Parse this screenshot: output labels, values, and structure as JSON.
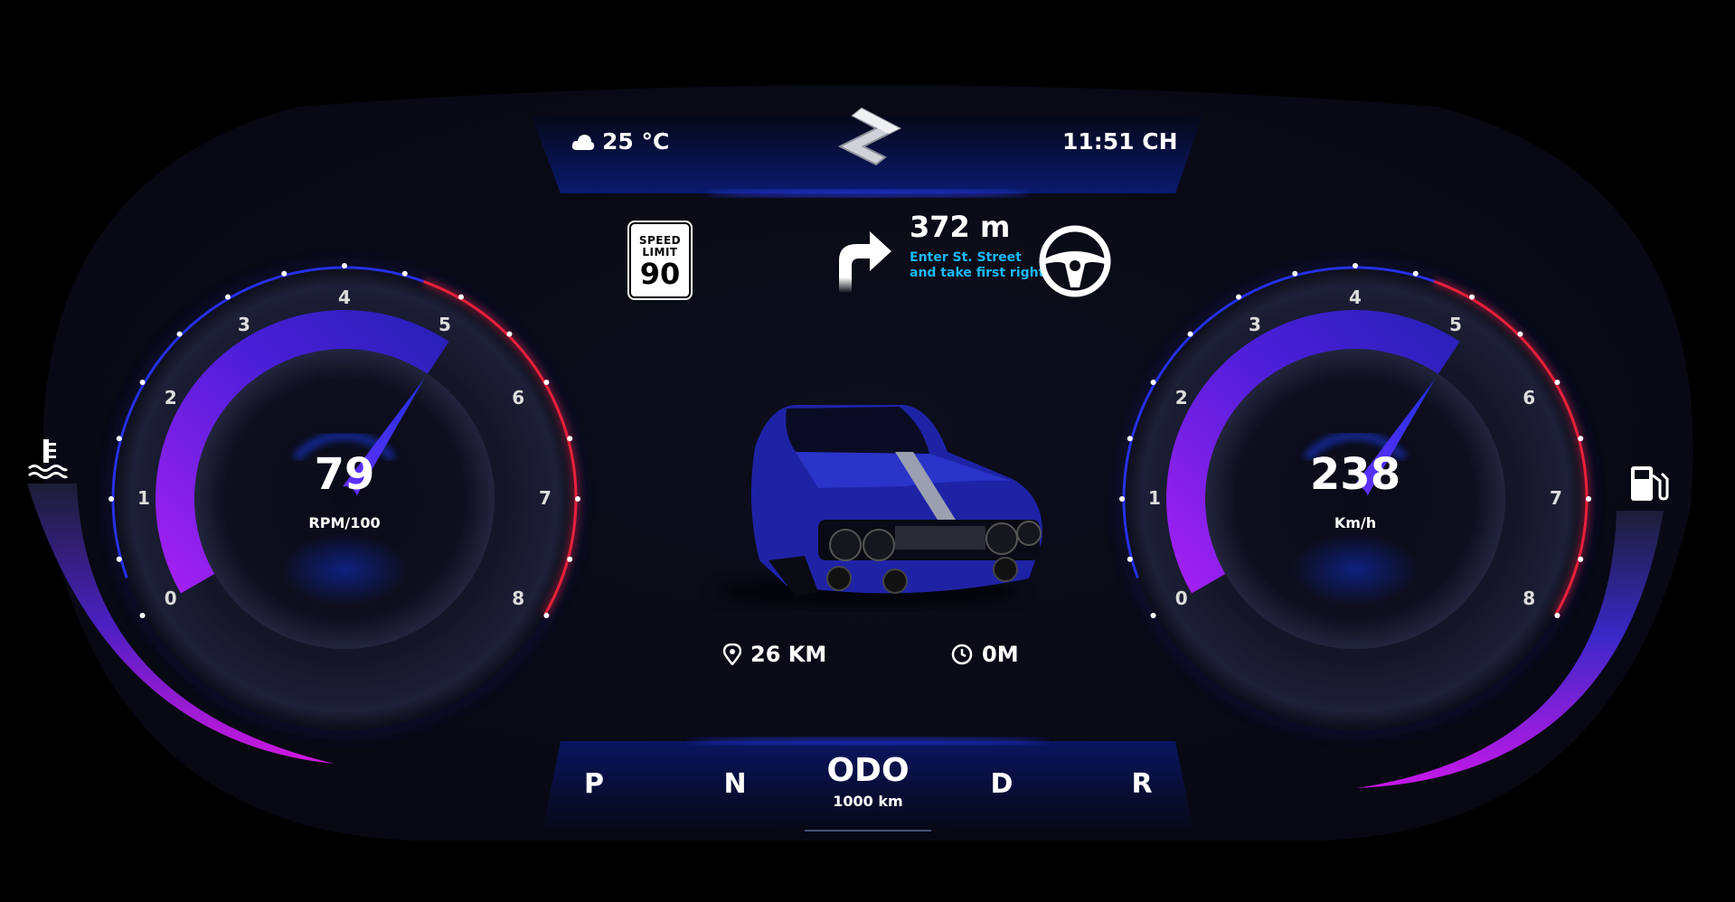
{
  "header": {
    "temperature": "25 °C",
    "time": "11:51 CH",
    "weather_icon": "cloud-icon",
    "logo": "suzuki-logo"
  },
  "speed_limit": {
    "label_line1": "SPEED",
    "label_line2": "LIMIT",
    "value": "90"
  },
  "navigation": {
    "distance": "372 m",
    "instruction": "Enter St. Street and take first right",
    "arrow_icon": "turn-right-icon",
    "wheel_icon": "steering-wheel-icon",
    "instruction_color": "#19b8f5"
  },
  "rpm_gauge": {
    "value": "79",
    "unit": "RPM/100",
    "ticks": [
      "0",
      "1",
      "2",
      "3",
      "4",
      "5",
      "6",
      "7",
      "8"
    ],
    "level_fraction": 0.64
  },
  "speed_gauge": {
    "value": "238",
    "unit": "Km/h",
    "ticks": [
      "0",
      "1",
      "2",
      "3",
      "4",
      "5",
      "6",
      "7",
      "8"
    ],
    "level_fraction": 0.64
  },
  "trip": {
    "distance": "26 KM",
    "time": "0M",
    "distance_icon": "location-pin-icon",
    "time_icon": "clock-icon"
  },
  "gear": {
    "items": [
      "P",
      "N",
      "D",
      "R"
    ],
    "odo_label": "ODO",
    "odo_value": "1000 km"
  },
  "side_bars": {
    "coolant_icon": "coolant-temperature-icon",
    "fuel_icon": "fuel-pump-icon"
  },
  "colors": {
    "background": "#000000",
    "panel": "#0a0c18",
    "accent_purple": "#8a18e6",
    "accent_blue": "#2020d0",
    "accent_red": "#ff2030"
  }
}
